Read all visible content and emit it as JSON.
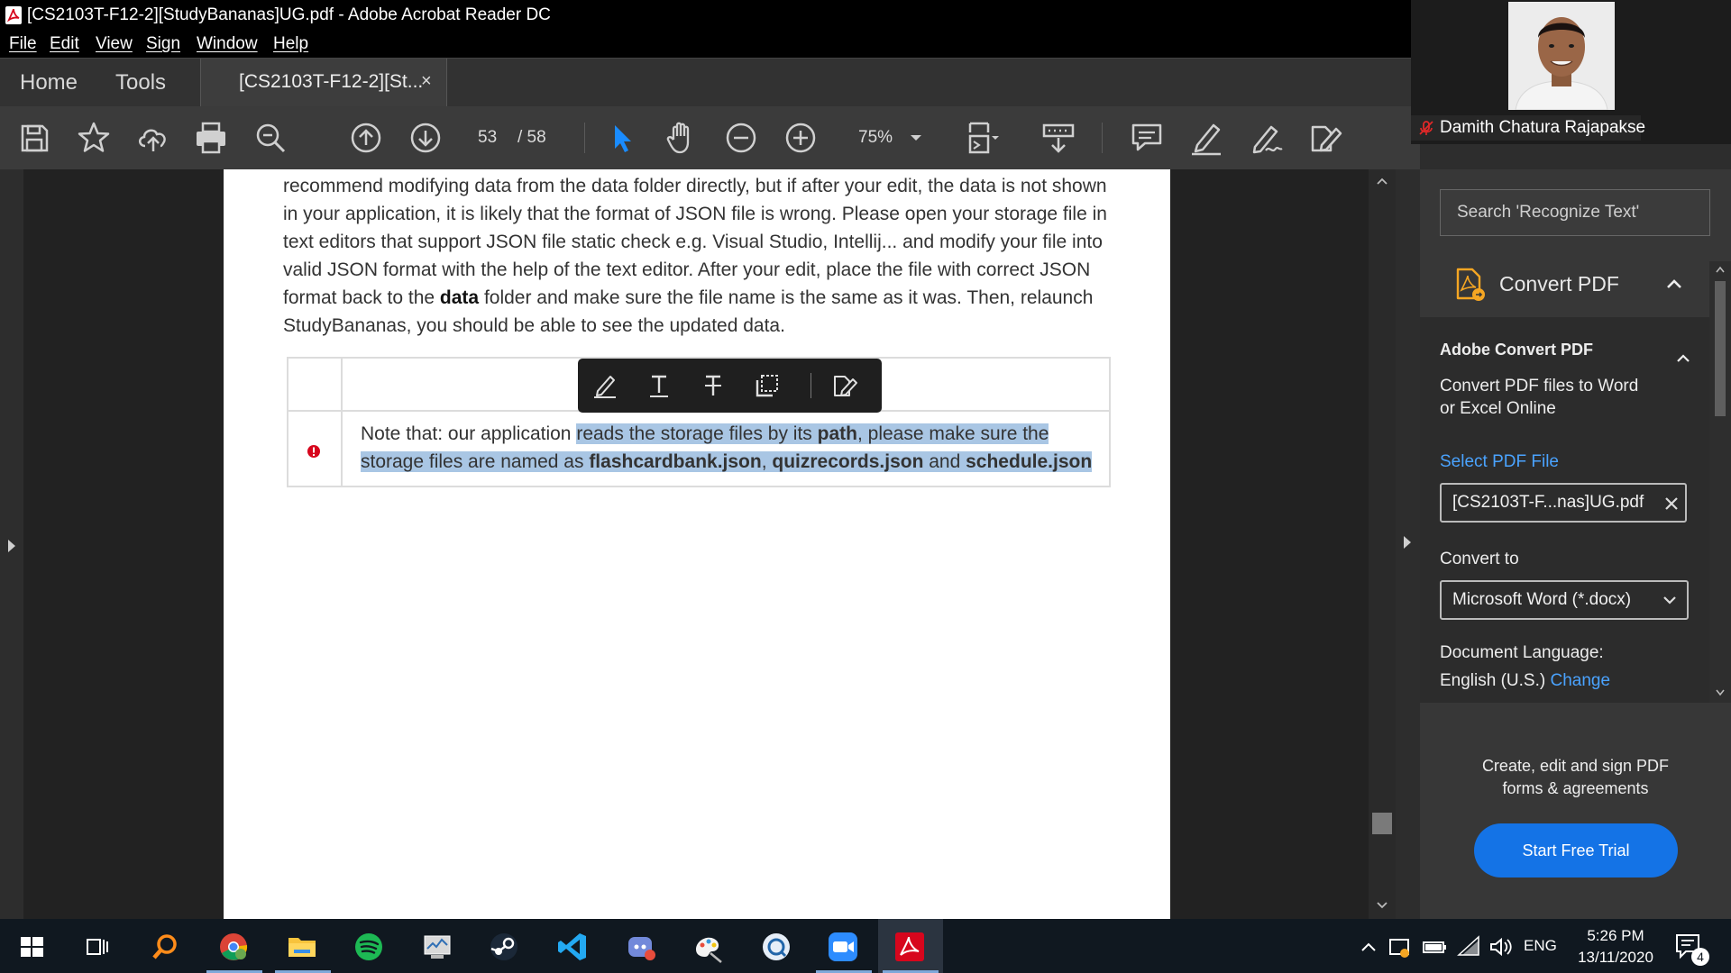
{
  "window": {
    "title": "[CS2103T-F12-2][StudyBananas]UG.pdf - Adobe Acrobat Reader DC"
  },
  "menu": [
    "File",
    "Edit",
    "View",
    "Sign",
    "Window",
    "Help"
  ],
  "tabs": {
    "home": "Home",
    "tools": "Tools",
    "document": "[CS2103T-F12-2][St...",
    "close": "×"
  },
  "toolbar": {
    "page_current": "53",
    "page_total": "/ 58",
    "zoom": "75%"
  },
  "document": {
    "lines": [
      "recommend modifying data from the data folder directly, but if after your edit, the data is not shown",
      "in your application, it is likely that the format of JSON file is wrong. Please open your storage file in",
      "text editors that support JSON file static check e.g. Visual Studio, Intellij... and modify your file into",
      "valid JSON format with the help of the text editor. After your edit, place the file with correct JSON"
    ],
    "line5_pre": "format back to the ",
    "line5_bold": "data",
    "line5_post": " folder and make sure the file name is the same as it was. Then, relaunch",
    "line6": "StudyBananas, you should be able to see the updated data.",
    "note": {
      "l1_pre": "Note that: our application ",
      "l1_hl": "reads the storage files by its ",
      "l1_bold": "path",
      "l1_post": ", please make sure the",
      "l2_pre": "storage files are named as ",
      "l2_b1": "flashcardbank.json",
      "l2_sep": ", ",
      "l2_b2": "quizrecords.json",
      "l2_and": " and ",
      "l2_b3": "schedule.json"
    }
  },
  "right_pane": {
    "search_placeholder": "Search 'Recognize Text'",
    "convert_title": "Convert PDF",
    "section_title": "Adobe Convert PDF",
    "desc_line1": "Convert PDF files to Word",
    "desc_line2": "or Excel Online",
    "select_label": "Select PDF File",
    "file_name": "[CS2103T-F...nas]UG.pdf",
    "convert_to_label": "Convert to",
    "convert_to_value": "Microsoft Word (*.docx)",
    "doc_lang_label": "Document Language:",
    "doc_lang_value": "English (U.S.)",
    "change_link": "Change",
    "promo_line1": "Create, edit and sign PDF",
    "promo_line2": "forms & agreements",
    "trial_button": "Start Free Trial"
  },
  "video": {
    "participant": "Damith Chatura Rajapakse"
  },
  "taskbar": {
    "lang": "ENG",
    "time": "5:26 PM",
    "date": "13/11/2020",
    "notifications": "4"
  },
  "colors": {
    "accent_blue": "#1473e6",
    "link_blue": "#4aa3ff",
    "selection": "#a9c6e4",
    "warning_red": "#d7061d"
  }
}
